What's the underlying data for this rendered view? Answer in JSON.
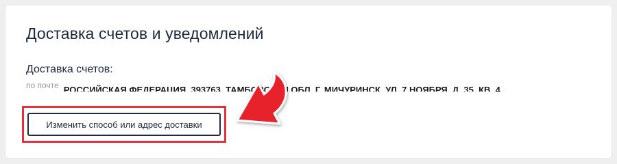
{
  "section": {
    "title": "Доставка счетов и уведомлений",
    "invoice_delivery_label": "Доставка счетов:",
    "delivery_method": "по почте",
    "delivery_address": "РОССИЙСКАЯ ФЕДЕРАЦИЯ, 393763, ТАМБОВСКАЯ ОБЛ, Г. МИЧУРИНСК, УЛ. 7 НОЯБРЯ, Д. 35, КВ. 4",
    "change_button_label": "Изменить способ или адрес доставки"
  },
  "annotation": {
    "highlight_color": "#e5303f",
    "arrow_color": "#e8202a"
  }
}
